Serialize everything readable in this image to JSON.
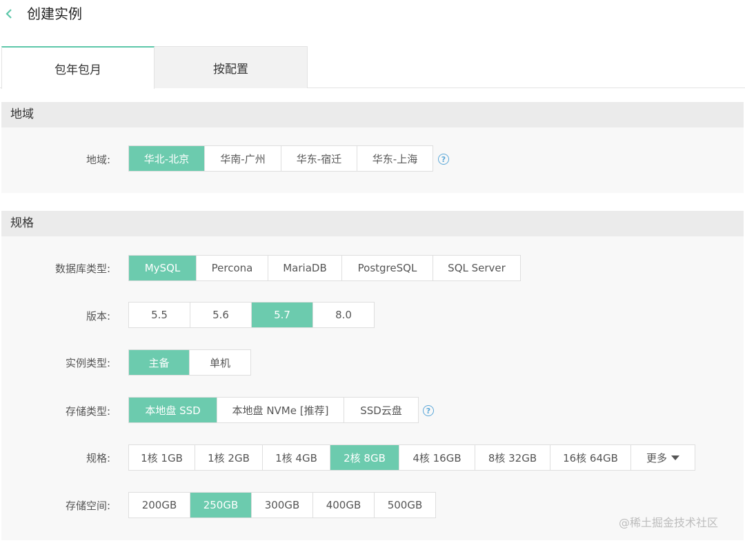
{
  "header": {
    "title": "创建实例",
    "back_icon": "chevron-left-icon"
  },
  "tabs": [
    {
      "label": "包年包月",
      "active": true
    },
    {
      "label": "按配置",
      "active": false
    }
  ],
  "region_section": {
    "title": "地域",
    "label": "地域:",
    "options": [
      "华北-北京",
      "华南-广州",
      "华东-宿迁",
      "华东-上海"
    ],
    "selected": "华北-北京",
    "help_icon": "question-circle-icon"
  },
  "spec_section": {
    "title": "规格",
    "db_type": {
      "label": "数据库类型:",
      "options": [
        "MySQL",
        "Percona",
        "MariaDB",
        "PostgreSQL",
        "SQL Server"
      ],
      "selected": "MySQL"
    },
    "version": {
      "label": "版本:",
      "options": [
        "5.5",
        "5.6",
        "5.7",
        "8.0"
      ],
      "selected": "5.7"
    },
    "instance_type": {
      "label": "实例类型:",
      "options": [
        "主备",
        "单机"
      ],
      "selected": "主备"
    },
    "storage_type": {
      "label": "存储类型:",
      "options": [
        "本地盘 SSD",
        "本地盘 NVMe [推荐]",
        "SSD云盘"
      ],
      "selected": "本地盘 SSD"
    },
    "spec": {
      "label": "规格:",
      "options": [
        "1核 1GB",
        "1核 2GB",
        "1核 4GB",
        "2核 8GB",
        "4核 16GB",
        "8核 32GB",
        "16核 64GB"
      ],
      "selected": "2核 8GB",
      "more_label": "更多"
    },
    "storage_space": {
      "label": "存储空间:",
      "options": [
        "200GB",
        "250GB",
        "300GB",
        "400GB",
        "500GB"
      ],
      "selected": "250GB"
    }
  },
  "watermark": "@稀土掘金技术社区",
  "colors": {
    "accent": "#6ccbae",
    "tab_accent": "#5cc7a9",
    "help": "#5aa7d8"
  }
}
